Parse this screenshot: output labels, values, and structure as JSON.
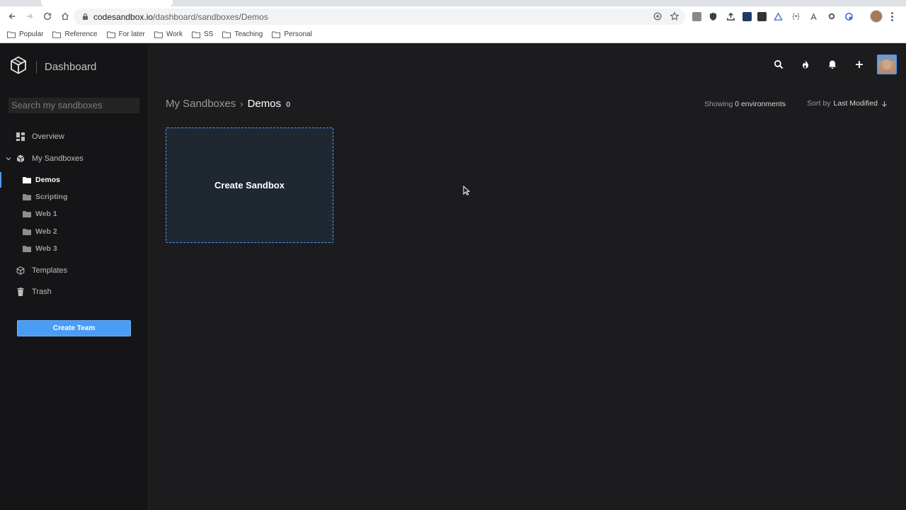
{
  "browser": {
    "url_host": "codesandbox.io",
    "url_path": "/dashboard/sandboxes/Demos",
    "bookmarks": [
      "Popular",
      "Reference",
      "For later",
      "Work",
      "SS",
      "Teaching",
      "Personal"
    ]
  },
  "app": {
    "brand_title": "Dashboard",
    "search": {
      "placeholder": "Search my sandboxes"
    },
    "nav": {
      "overview": "Overview",
      "my_sandboxes": "My Sandboxes",
      "folders": [
        "Demos",
        "Scripting",
        "Web 1",
        "Web 2",
        "Web 3"
      ],
      "templates": "Templates",
      "trash": "Trash"
    },
    "create_team_label": "Create Team"
  },
  "main": {
    "breadcrumb": {
      "root": "My Sandboxes",
      "separator": "›",
      "current": "Demos",
      "count": "0"
    },
    "showing": {
      "prefix": "Showing",
      "value": "0 environments"
    },
    "sort": {
      "prefix": "Sort by",
      "value": "Last Modified"
    },
    "create_card_label": "Create Sandbox"
  },
  "colors": {
    "accent": "#4b9cf5",
    "background": "#1c1c1f",
    "sidebar": "#151517"
  }
}
